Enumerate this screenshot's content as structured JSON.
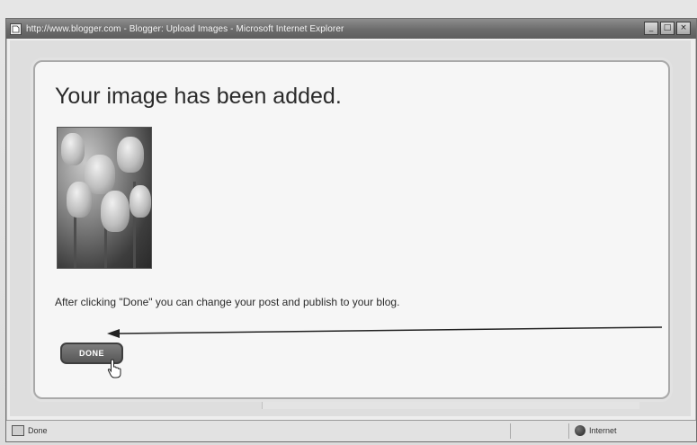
{
  "window": {
    "title": "http://www.blogger.com - Blogger: Upload Images - Microsoft Internet Explorer",
    "controls": [
      "minimize-icon",
      "maximize-icon",
      "close-icon"
    ]
  },
  "dialog": {
    "heading": "Your image has been added.",
    "message": "After clicking \"Done\" you can change your post and publish to your blog.",
    "done_label": "DONE"
  },
  "statusbar": {
    "left_text": "Done",
    "zone_text": "Internet"
  }
}
